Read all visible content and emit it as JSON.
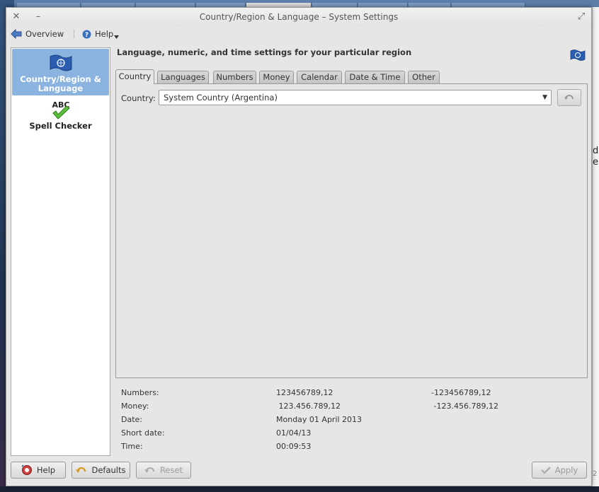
{
  "window": {
    "title": "Country/Region & Language – System Settings",
    "close_glyph": "✕",
    "minimize_glyph": "–",
    "maximize_glyph": "⤢"
  },
  "toolbar": {
    "overview_label": "Overview",
    "help_label": "Help"
  },
  "sidebar": {
    "items": [
      {
        "label": "Country/Region & Language",
        "icon": "un-flag-icon",
        "selected": true
      },
      {
        "label": "Spell Checker",
        "icon": "abc-check-icon",
        "icon_text": "ABC",
        "selected": false
      }
    ]
  },
  "content": {
    "heading": "Language, numeric, and time settings for your particular region"
  },
  "tabs": [
    "Country",
    "Languages",
    "Numbers",
    "Money",
    "Calendar",
    "Date & Time",
    "Other"
  ],
  "country": {
    "label": "Country:",
    "value": "System Country (Argentina)"
  },
  "preview": [
    {
      "label": "Numbers:",
      "value1": "123456789,12",
      "value2": "-123456789,12"
    },
    {
      "label": "Money:",
      "value1": " 123.456.789,12",
      "value2": " -123.456.789,12"
    },
    {
      "label": "Date:",
      "value1": "Monday 01 April 2013",
      "value2": ""
    },
    {
      "label": "Short date:",
      "value1": "01/04/13",
      "value2": ""
    },
    {
      "label": "Time:",
      "value1": "00:09:53",
      "value2": ""
    }
  ],
  "buttons": {
    "help": "Help",
    "defaults": "Defaults",
    "reset": "Reset",
    "apply": "Apply"
  },
  "background_window": {
    "edge_text_1": "d",
    "edge_text_2": "er",
    "edge_text_3": "2"
  },
  "colors": {
    "selected_sidebar": "#8ab3e0",
    "flag_blue": "#2a5db0"
  }
}
